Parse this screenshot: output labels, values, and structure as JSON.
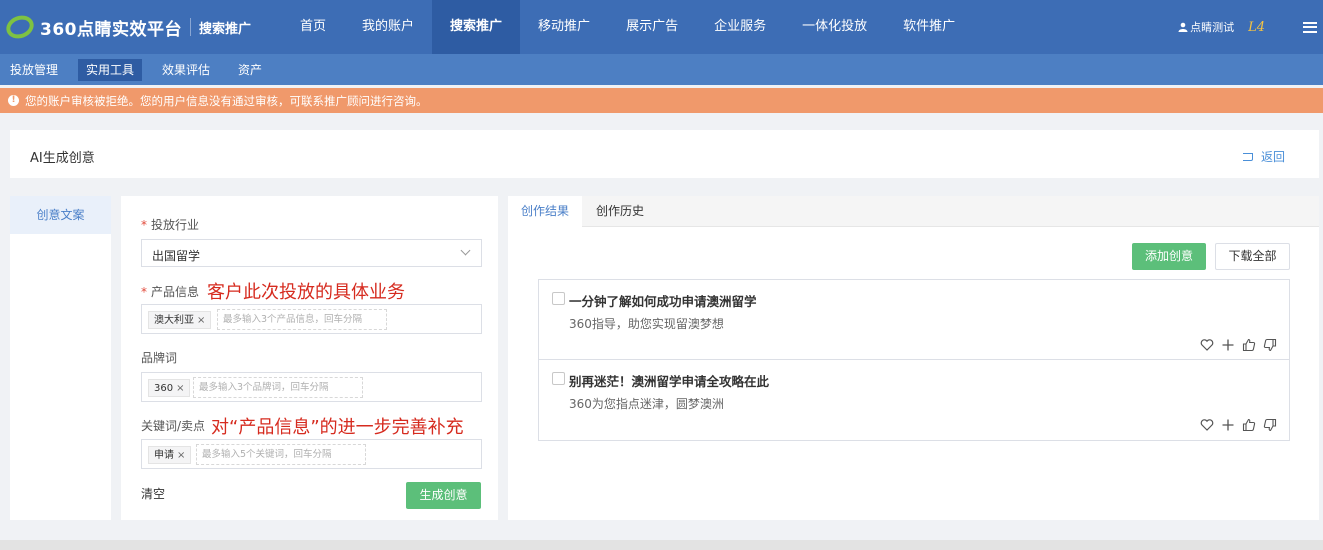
{
  "brand": {
    "name": "360点睛实效平台",
    "product": "搜索推广"
  },
  "nav": {
    "items": [
      "首页",
      "我的账户",
      "搜索推广",
      "移动推广",
      "展示广告",
      "企业服务",
      "一体化投放",
      "软件推广"
    ]
  },
  "user": {
    "name": "点睛测试",
    "level": "L4"
  },
  "subnav": {
    "items": [
      "投放管理",
      "实用工具",
      "效果评估",
      "资产"
    ]
  },
  "alert": {
    "icon_char": "!",
    "text": "您的账户审核被拒绝。您的用户信息没有通过审核，可联系推广顾问进行咨询。"
  },
  "page": {
    "title": "AI生成创意",
    "back_label": "返回"
  },
  "left_tab": {
    "label": "创意文案"
  },
  "form": {
    "required_mark": "*",
    "industry": {
      "label": "投放行业",
      "value": "出国留学"
    },
    "product": {
      "label": "产品信息",
      "annotation": "客户此次投放的具体业务",
      "tag": "澳大利亚",
      "placeholder": "最多输入3个产品信息，回车分隔"
    },
    "brand": {
      "label": "品牌词",
      "tag": "360",
      "placeholder": "最多输入3个品牌词，回车分隔"
    },
    "keywords": {
      "label": "关键词/卖点",
      "annotation": "对“产品信息”的进一步完善补充",
      "tag": "申请",
      "placeholder": "最多输入5个关键词，回车分隔"
    },
    "tag_remove": "×",
    "clear_label": "清空",
    "generate_label": "生成创意"
  },
  "results": {
    "tabs": [
      "创作结果",
      "创作历史"
    ],
    "add_label": "添加创意",
    "download_label": "下载全部",
    "cards": [
      {
        "title": "一分钟了解如何成功申请澳洲留学",
        "subtitle": "360指导，助您实现留澳梦想"
      },
      {
        "title": "别再迷茫！澳洲留学申请全攻略在此",
        "subtitle": "360为您指点迷津，圆梦澳洲"
      }
    ]
  },
  "colors": {
    "topbar": "#3d6db5",
    "subbar": "#4d7fc3",
    "alert": "#f0996b",
    "primary_green": "#5cbf7a",
    "link_blue": "#4a8fd8",
    "annotation_red": "#d62b1f"
  },
  "icons": {
    "favorite": "heart-icon",
    "add": "plus-icon",
    "like": "thumbs-up-icon",
    "dislike": "thumbs-down-icon"
  }
}
